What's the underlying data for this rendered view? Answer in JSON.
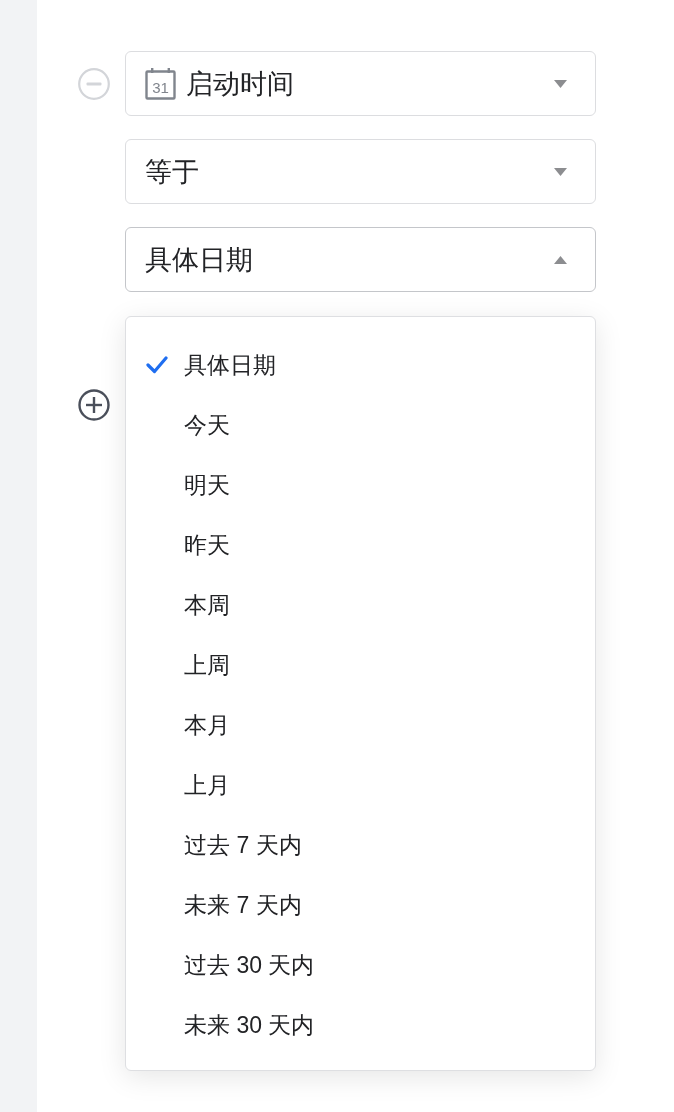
{
  "condition": {
    "field": {
      "value": "启动时间",
      "icon_label": "31",
      "open": false
    },
    "operator": {
      "value": "等于",
      "open": false
    },
    "date_mode": {
      "value": "具体日期",
      "open": true
    }
  },
  "menu": {
    "items": [
      {
        "label": "具体日期",
        "selected": true
      },
      {
        "label": "今天",
        "selected": false
      },
      {
        "label": "明天",
        "selected": false
      },
      {
        "label": "昨天",
        "selected": false
      },
      {
        "label": "本周",
        "selected": false
      },
      {
        "label": "上周",
        "selected": false
      },
      {
        "label": "本月",
        "selected": false
      },
      {
        "label": "上月",
        "selected": false
      },
      {
        "label": "过去 7 天内",
        "selected": false
      },
      {
        "label": "未来 7 天内",
        "selected": false
      },
      {
        "label": "过去 30 天内",
        "selected": false
      },
      {
        "label": "未来 30 天内",
        "selected": false
      }
    ]
  }
}
